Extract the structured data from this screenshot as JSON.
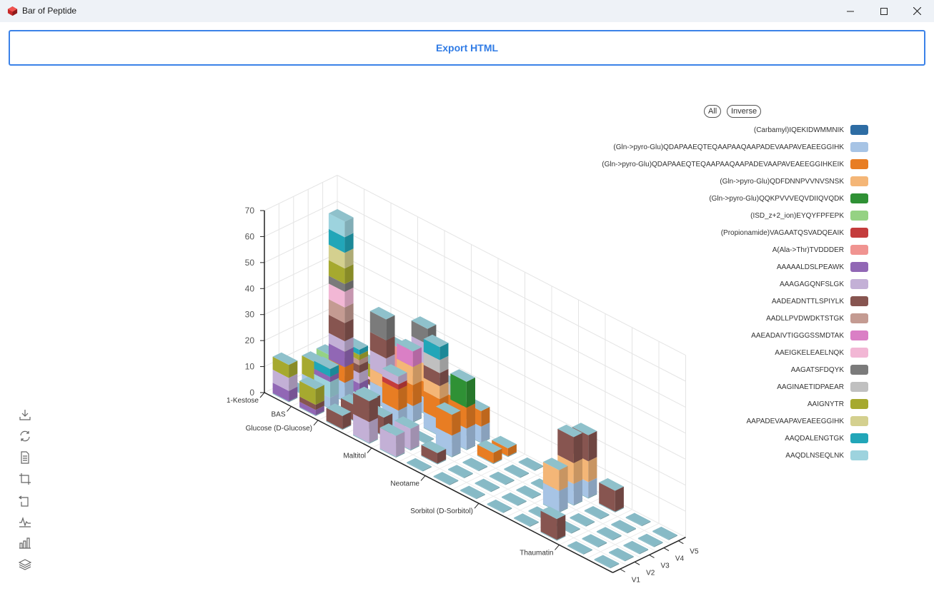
{
  "window": {
    "title": "Bar of Peptide"
  },
  "toolbar": {
    "export_label": "Export HTML"
  },
  "legend": {
    "all_label": "All",
    "inverse_label": "Inverse"
  },
  "tools": [
    "download-icon",
    "refresh-icon",
    "data-view-icon",
    "zoom-icon",
    "zoom-reset-icon",
    "line-chart-icon",
    "bar-chart-icon",
    "stack-icon"
  ],
  "chart_data": {
    "type": "bar3d-stacked",
    "z_range": [
      0,
      70
    ],
    "z_ticks": [
      0,
      10,
      20,
      30,
      40,
      50,
      60,
      70
    ],
    "x_categories": [
      "1-Kestose",
      "BAS",
      "Glucose (D-Glucose)",
      "Maltitol",
      "Neotame",
      "Sorbitol (D-Sorbitol)",
      "Thaumatin"
    ],
    "x_tick_labels": [
      "1-Kestose",
      "BAS",
      "Glucose (D-Glucose)",
      "Maltitol",
      "Neotame",
      "Sorbitol (D-Sorbitol)",
      "Thaumatin"
    ],
    "x_rows": 13,
    "y_categories": [
      "V1",
      "V2",
      "V3",
      "V4",
      "V5"
    ],
    "grid": true,
    "series": [
      {
        "name": "(Carbamyl)IQEKIDWMMNIK",
        "color": "#2e6da4"
      },
      {
        "name": "(Gln->pyro-Glu)QDAPAAEQTEQAAPAAQAAPADEVAAPAVEAEEGGIHK",
        "color": "#a7c4e5"
      },
      {
        "name": "(Gln->pyro-Glu)QDAPAAEQTEQAAPAAQAAPADEVAAPAVEAEEGGIHKEIK",
        "color": "#e87d23"
      },
      {
        "name": "(Gln->pyro-Glu)QDFDNNPVVNVSNSK",
        "color": "#f4b677"
      },
      {
        "name": "(Gln->pyro-Glu)QQKPVVVEQVDIIQVQDK",
        "color": "#2f9135"
      },
      {
        "name": "(ISD_z+2_ion)EYQYFPFEPK",
        "color": "#95d283"
      },
      {
        "name": "(Propionamide)VAGAATQSVADQEAIK",
        "color": "#c43c3c"
      },
      {
        "name": "A(Ala->Thr)TVDDDER",
        "color": "#f09491"
      },
      {
        "name": "AAAAALDSLPEAWK",
        "color": "#9167b5"
      },
      {
        "name": "AAAGAGQNFSLGK",
        "color": "#c3b0d6"
      },
      {
        "name": "AADEADNTTLSPIYLK",
        "color": "#875550"
      },
      {
        "name": "AADLLPVDWDKTSTGK",
        "color": "#c49b92"
      },
      {
        "name": "AAEADAIVTIGGGSSMDTAK",
        "color": "#da7fc5"
      },
      {
        "name": "AAEIGKELEAELNQK",
        "color": "#f2b7d5"
      },
      {
        "name": "AAGATSFDQYK",
        "color": "#7b7b7b"
      },
      {
        "name": "AAGINAETIDPAEAR",
        "color": "#c0c0c0"
      },
      {
        "name": "AAIGNYTR",
        "color": "#a6a92f"
      },
      {
        "name": "AAPADEVAAPAVEAEEGGIHK",
        "color": "#d4d08f"
      },
      {
        "name": "AAQDALENGTGK",
        "color": "#22a6b8"
      },
      {
        "name": "AAQDLNSEQLNK",
        "color": "#9dd3de"
      }
    ],
    "bars": [
      {
        "x": 0,
        "y": 0,
        "stack": [
          [
            8,
            4
          ],
          [
            9,
            5
          ],
          [
            16,
            5
          ]
        ]
      },
      {
        "x": 0,
        "y": 2,
        "stack": [
          [
            1,
            2
          ],
          [
            16,
            7
          ]
        ]
      },
      {
        "x": 0,
        "y": 3,
        "stack": [
          [
            1,
            3
          ],
          [
            10,
            2
          ],
          [
            5,
            4
          ]
        ]
      },
      {
        "x": 1,
        "y": 0,
        "stack": [
          [
            8,
            2
          ],
          [
            10,
            2
          ],
          [
            16,
            6
          ]
        ]
      },
      {
        "x": 1,
        "y": 1,
        "stack": [
          [
            1,
            4
          ],
          [
            19,
            6
          ],
          [
            8,
            2
          ],
          [
            18,
            3
          ]
        ]
      },
      {
        "x": 1,
        "y": 2,
        "stack": [
          [
            1,
            7
          ],
          [
            2,
            6
          ],
          [
            8,
            6
          ],
          [
            9,
            4
          ],
          [
            10,
            7
          ],
          [
            11,
            6
          ],
          [
            13,
            6
          ],
          [
            14,
            3
          ],
          [
            16,
            6
          ],
          [
            17,
            6
          ],
          [
            18,
            6
          ],
          [
            19,
            6
          ]
        ]
      },
      {
        "x": 1,
        "y": 3,
        "stack": [
          [
            8,
            4
          ],
          [
            9,
            4
          ],
          [
            10,
            3
          ],
          [
            11,
            2
          ],
          [
            16,
            2
          ],
          [
            18,
            2
          ]
        ]
      },
      {
        "x": 1,
        "y": 4,
        "stack": [
          [
            10,
            2
          ],
          [
            13,
            1
          ],
          [
            16,
            5
          ]
        ]
      },
      {
        "x": 2,
        "y": 0,
        "stack": [
          [
            10,
            5
          ]
        ]
      },
      {
        "x": 2,
        "y": 1,
        "stack": [
          [
            10,
            6
          ]
        ]
      },
      {
        "x": 2,
        "y": 2,
        "stack": [
          [
            10,
            6
          ]
        ]
      },
      {
        "x": 2,
        "y": 3,
        "stack": [
          [
            1,
            7
          ],
          [
            3,
            5
          ],
          [
            9,
            7
          ],
          [
            10,
            7
          ],
          [
            14,
            8
          ]
        ]
      },
      {
        "x": 2,
        "y": 4,
        "stack": [
          [
            1,
            6
          ],
          [
            3,
            6
          ],
          [
            7,
            8
          ]
        ]
      },
      {
        "x": 3,
        "y": 0,
        "stack": [
          [
            9,
            8
          ],
          [
            10,
            8
          ]
        ]
      },
      {
        "x": 3,
        "y": 1,
        "stack": [
          [
            10,
            7
          ]
        ]
      },
      {
        "x": 3,
        "y": 2,
        "stack": [
          [
            1,
            7
          ],
          [
            2,
            8
          ],
          [
            6,
            2
          ],
          [
            9,
            3
          ]
        ]
      },
      {
        "x": 3,
        "y": 3,
        "stack": [
          [
            1,
            6
          ],
          [
            2,
            8
          ],
          [
            3,
            7
          ],
          [
            12,
            6
          ]
        ]
      },
      {
        "x": 3,
        "y": 4,
        "stack": [
          [
            1,
            6
          ],
          [
            2,
            6
          ],
          [
            3,
            7
          ],
          [
            9,
            8
          ],
          [
            14,
            6
          ]
        ]
      },
      {
        "x": 4,
        "y": 0,
        "stack": [
          [
            9,
            8
          ]
        ]
      },
      {
        "x": 4,
        "y": 1,
        "stack": [
          [
            9,
            8
          ]
        ]
      },
      {
        "x": 4,
        "y": 3,
        "stack": [
          [
            1,
            6
          ],
          [
            2,
            8
          ],
          [
            3,
            5
          ],
          [
            10,
            5
          ],
          [
            15,
            5
          ],
          [
            18,
            5
          ]
        ]
      },
      {
        "x": 4,
        "y": 4,
        "stack": [
          [
            1,
            5
          ],
          [
            2,
            7
          ],
          [
            15,
            4
          ]
        ]
      },
      {
        "x": 5,
        "y": 1,
        "stack": [
          [
            10,
            4
          ]
        ]
      },
      {
        "x": 5,
        "y": 2,
        "stack": [
          [
            1,
            8
          ],
          [
            2,
            8
          ]
        ]
      },
      {
        "x": 5,
        "y": 3,
        "stack": [
          [
            1,
            8
          ],
          [
            2,
            8
          ],
          [
            4,
            10
          ]
        ]
      },
      {
        "x": 5,
        "y": 4,
        "stack": [
          [
            1,
            6
          ],
          [
            2,
            6
          ]
        ]
      },
      {
        "x": 6,
        "y": 3,
        "stack": [
          [
            2,
            4
          ]
        ]
      },
      {
        "x": 6,
        "y": 4,
        "stack": [
          [
            2,
            3
          ]
        ]
      },
      {
        "x": 9,
        "y": 2,
        "stack": [
          [
            1,
            8
          ],
          [
            3,
            8
          ]
        ]
      },
      {
        "x": 9,
        "y": 3,
        "stack": [
          [
            1,
            8
          ],
          [
            3,
            8
          ],
          [
            10,
            10
          ]
        ]
      },
      {
        "x": 9,
        "y": 4,
        "stack": [
          [
            1,
            6
          ],
          [
            3,
            8
          ],
          [
            10,
            10
          ]
        ]
      },
      {
        "x": 10,
        "y": 0,
        "stack": [
          [
            10,
            8
          ]
        ]
      },
      {
        "x": 10,
        "y": 4,
        "stack": [
          [
            10,
            8
          ]
        ]
      }
    ]
  }
}
